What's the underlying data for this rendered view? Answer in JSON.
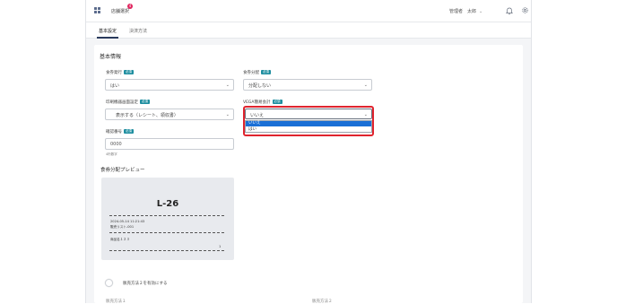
{
  "header": {
    "store_label": "店舗選択",
    "store_badge": "4",
    "user_label": "管理者　太郎",
    "user_chevron": "⌄"
  },
  "tabs": [
    {
      "label": "基本設定",
      "active": true
    },
    {
      "label": "決済方法",
      "active": false
    }
  ],
  "basic_info": {
    "title": "基本情報",
    "required_badge": "必須",
    "fields": {
      "ticket_issue": {
        "label": "食券発行",
        "value": "はい"
      },
      "ticket_split": {
        "label": "食券分配",
        "value": "分配しない"
      },
      "print_receipt": {
        "label": "印刷機器画面設定",
        "value": "表示する（レシート、領収書）"
      },
      "vega_mode": {
        "label": "VEGA簡易会計",
        "value": "いいえ",
        "options": [
          "いいえ",
          "はい"
        ]
      },
      "confirm_number": {
        "label": "確認番号",
        "value": "0000",
        "hint": "4桁数字"
      }
    }
  },
  "preview": {
    "title": "食券分配プレビュー",
    "receipt_title": "L-26",
    "datetime": "2024-05-14 11:21:43",
    "register": "販売リスト-001",
    "item_name": "商品名１２３",
    "qty": "1"
  },
  "payment2": {
    "toggle_label": "販売方法２を有効にする",
    "left_label": "販売方法１",
    "right_label": "販売方法２"
  },
  "colors": {
    "accent": "#1e8ea0",
    "highlight": "#e0242e",
    "selected_option": "#1a6fd6"
  }
}
